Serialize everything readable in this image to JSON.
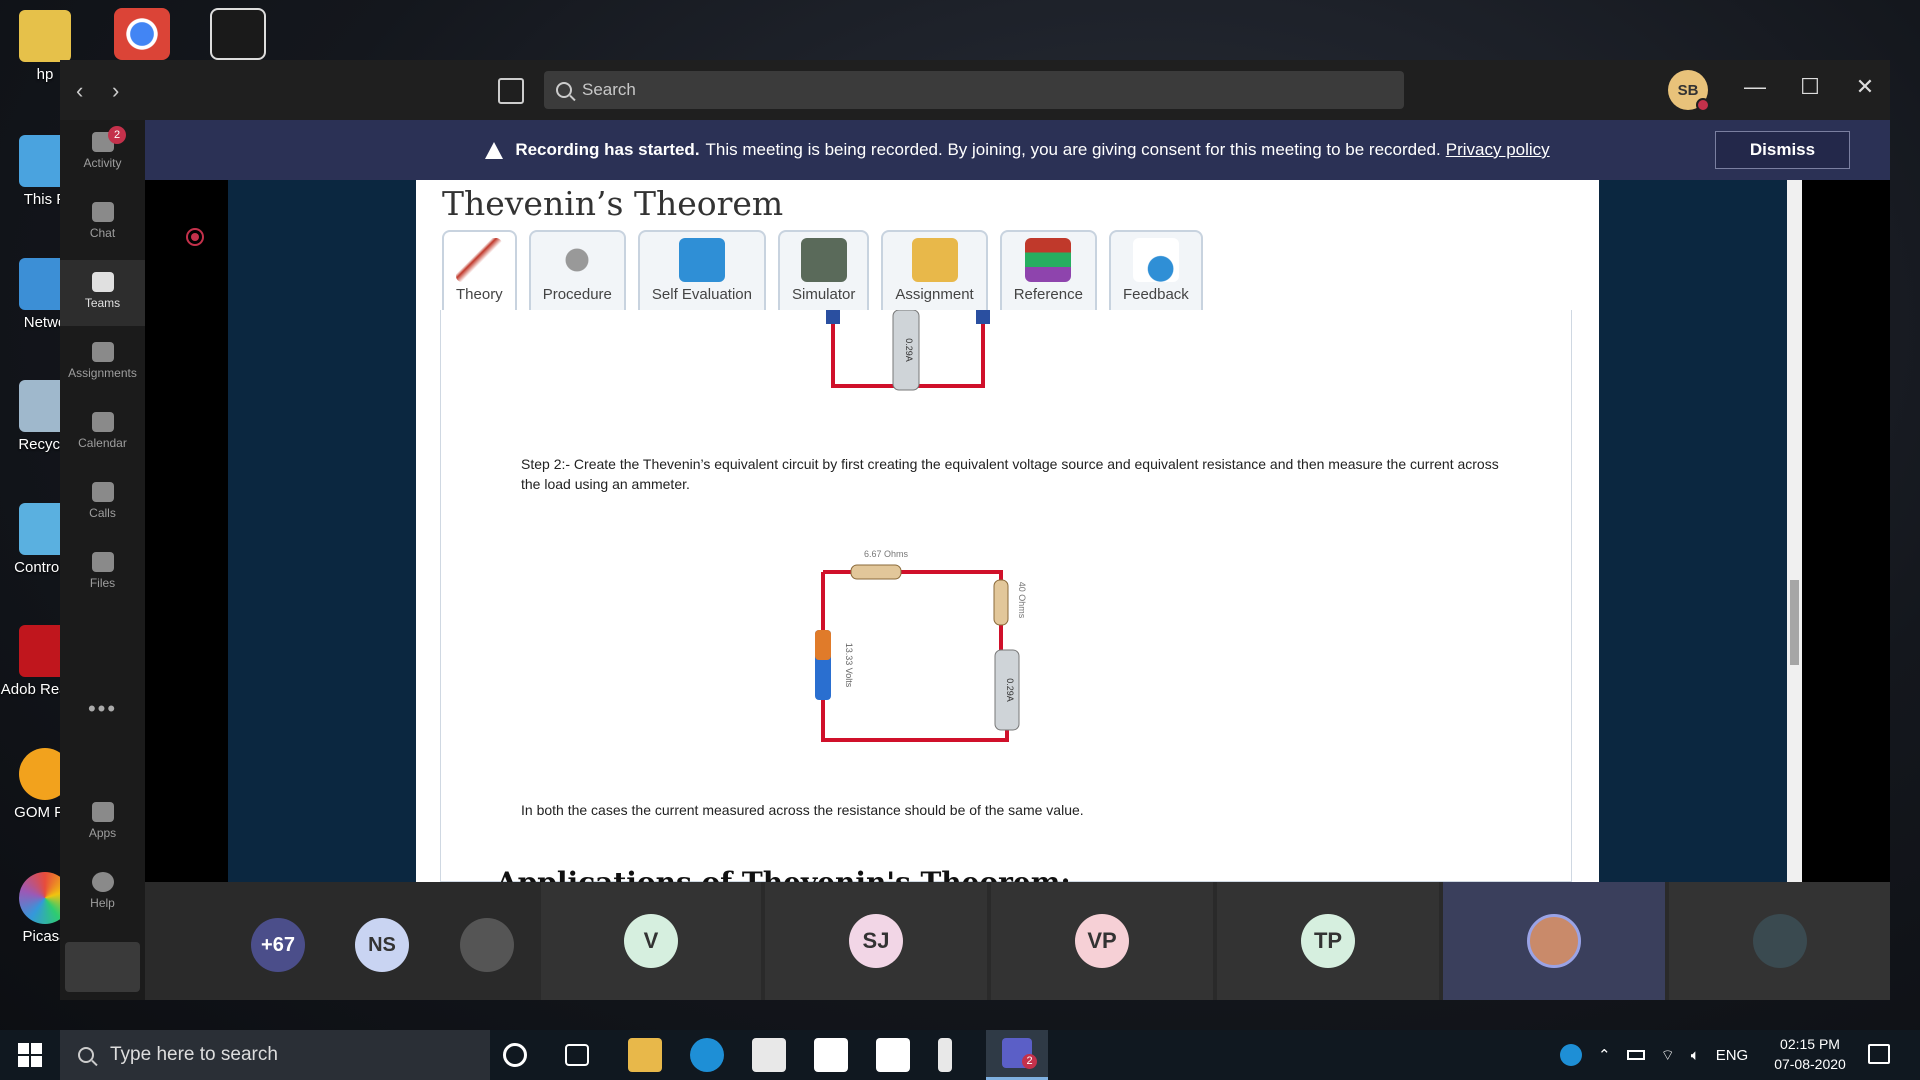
{
  "desktop": {
    "icons": [
      {
        "label": "hp",
        "color": "#e6c14a"
      },
      {
        "label": "This P",
        "color": "#4aa3df"
      },
      {
        "label": "Netwo",
        "color": "#3c8fd6"
      },
      {
        "label": "Recycle",
        "color": "#9fb8cc"
      },
      {
        "label": "Control F",
        "color": "#5ab0e0"
      },
      {
        "label": "Adob Reader",
        "color": "#c0161d"
      },
      {
        "label": "GOM Pla",
        "color": "#f2a21d"
      },
      {
        "label": "Picasa",
        "color": "#7a5fc0"
      }
    ]
  },
  "teams": {
    "search_placeholder": "Search",
    "user_initials": "SB",
    "rail": [
      {
        "label": "Activity",
        "badge": "2"
      },
      {
        "label": "Chat"
      },
      {
        "label": "Teams",
        "active": true
      },
      {
        "label": "Assignments"
      },
      {
        "label": "Calendar"
      },
      {
        "label": "Calls"
      },
      {
        "label": "Files"
      },
      {
        "label": "Apps"
      },
      {
        "label": "Help"
      }
    ],
    "banner": {
      "bold": "Recording has started.",
      "text": "This meeting is being recorded. By joining, you are giving consent for this meeting to be recorded.",
      "link": "Privacy policy",
      "dismiss": "Dismiss"
    }
  },
  "shared_page": {
    "title": "Thevenin’s Theorem",
    "tabs": [
      "Theory",
      "Procedure",
      "Self Evaluation",
      "Simulator",
      "Assignment",
      "Reference",
      "Feedback"
    ],
    "ammeter_top": "0.29A",
    "step2": "Step 2:- Create the Thevenin’s equivalent circuit by first creating the equivalent voltage source and equivalent resistance and then measure the current across the load using an ammeter.",
    "circuit": {
      "resistor1": "6.67 Ohms",
      "resistor2": "40 Ohms",
      "source": "13.33 Volts",
      "ammeter": "0.29A"
    },
    "conclusion": "In both the cases the current measured across the resistance should be of the same value.",
    "next_heading": "Applications of Thevenin's Theorem:"
  },
  "participants": {
    "overflow": "+67",
    "small": [
      {
        "initials": "NS",
        "color": "#c9d4f2"
      },
      {
        "initials": "",
        "color": "#555555"
      }
    ],
    "tiles": [
      {
        "initials": "V",
        "color": "#d6efdf"
      },
      {
        "initials": "SJ",
        "color": "#f2d6e6"
      },
      {
        "initials": "VP",
        "color": "#f6d0d6"
      },
      {
        "initials": "TP",
        "color": "#d6efdf"
      },
      {
        "initials": "",
        "color": "#c98a6a"
      },
      {
        "initials": "",
        "color": "#3a4a50"
      }
    ]
  },
  "taskbar": {
    "search_placeholder": "Type here to search",
    "teams_badge": "2",
    "language": "ENG",
    "time": "02:15 PM",
    "date": "07-08-2020"
  }
}
